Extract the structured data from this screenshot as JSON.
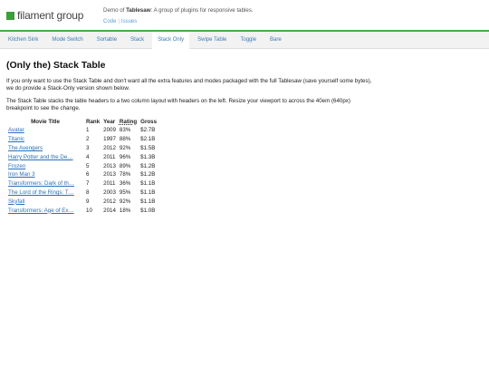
{
  "header": {
    "logo_text": "filament group",
    "demo_prefix": "Demo of ",
    "demo_name": "Tablesaw",
    "demo_suffix": ": A group of plugins for responsive tables.",
    "link_code": "Code",
    "link_issues": "Issues",
    "link_sep": "|"
  },
  "nav": {
    "items": [
      {
        "label": "Kitchen Sink"
      },
      {
        "label": "Mode Switch"
      },
      {
        "label": "Sortable"
      },
      {
        "label": "Stack"
      },
      {
        "label": "Stack Only"
      },
      {
        "label": "Swipe Table"
      },
      {
        "label": "Toggle"
      },
      {
        "label": "Bare"
      }
    ],
    "active_index": 4
  },
  "main": {
    "title": "(Only the) Stack Table",
    "para1": "If you only want to use the Stack Table and don't want all the extra features and modes packaged with the full Tablesaw (save yourself some bytes), we do provide a Stack-Only version shown below.",
    "para2": "The Stack Table stacks the table headers to a two column layout with headers on the left. Resize your viewport to across the 40em (640px) breakpoint to see the change."
  },
  "table": {
    "headers": {
      "title": "Movie Title",
      "rank": "Rank",
      "year": "Year",
      "rating": "Rating",
      "gross": "Gross"
    },
    "rows": [
      {
        "title": "Avatar",
        "rank": "1",
        "year": "2009",
        "rating": "83%",
        "gross": "$2.7B"
      },
      {
        "title": "Titanic",
        "rank": "2",
        "year": "1997",
        "rating": "88%",
        "gross": "$2.1B"
      },
      {
        "title": "The Avengers",
        "rank": "3",
        "year": "2012",
        "rating": "92%",
        "gross": "$1.5B"
      },
      {
        "title": "Harry Potter and the De…",
        "rank": "4",
        "year": "2011",
        "rating": "96%",
        "gross": "$1.3B"
      },
      {
        "title": "Frozen",
        "rank": "5",
        "year": "2013",
        "rating": "89%",
        "gross": "$1.2B"
      },
      {
        "title": "Iron Man 3",
        "rank": "6",
        "year": "2013",
        "rating": "78%",
        "gross": "$1.2B"
      },
      {
        "title": "Transformers: Dark of th…",
        "rank": "7",
        "year": "2011",
        "rating": "36%",
        "gross": "$1.1B"
      },
      {
        "title": "The Lord of the Rings: T…",
        "rank": "8",
        "year": "2003",
        "rating": "95%",
        "gross": "$1.1B"
      },
      {
        "title": "Skyfall",
        "rank": "9",
        "year": "2012",
        "rating": "92%",
        "gross": "$1.1B"
      },
      {
        "title": "Transformers: Age of Ex…",
        "rank": "10",
        "year": "2014",
        "rating": "18%",
        "gross": "$1.0B"
      }
    ]
  },
  "colors": {
    "accent": "#4aa84a",
    "link": "#2a6fb8"
  }
}
